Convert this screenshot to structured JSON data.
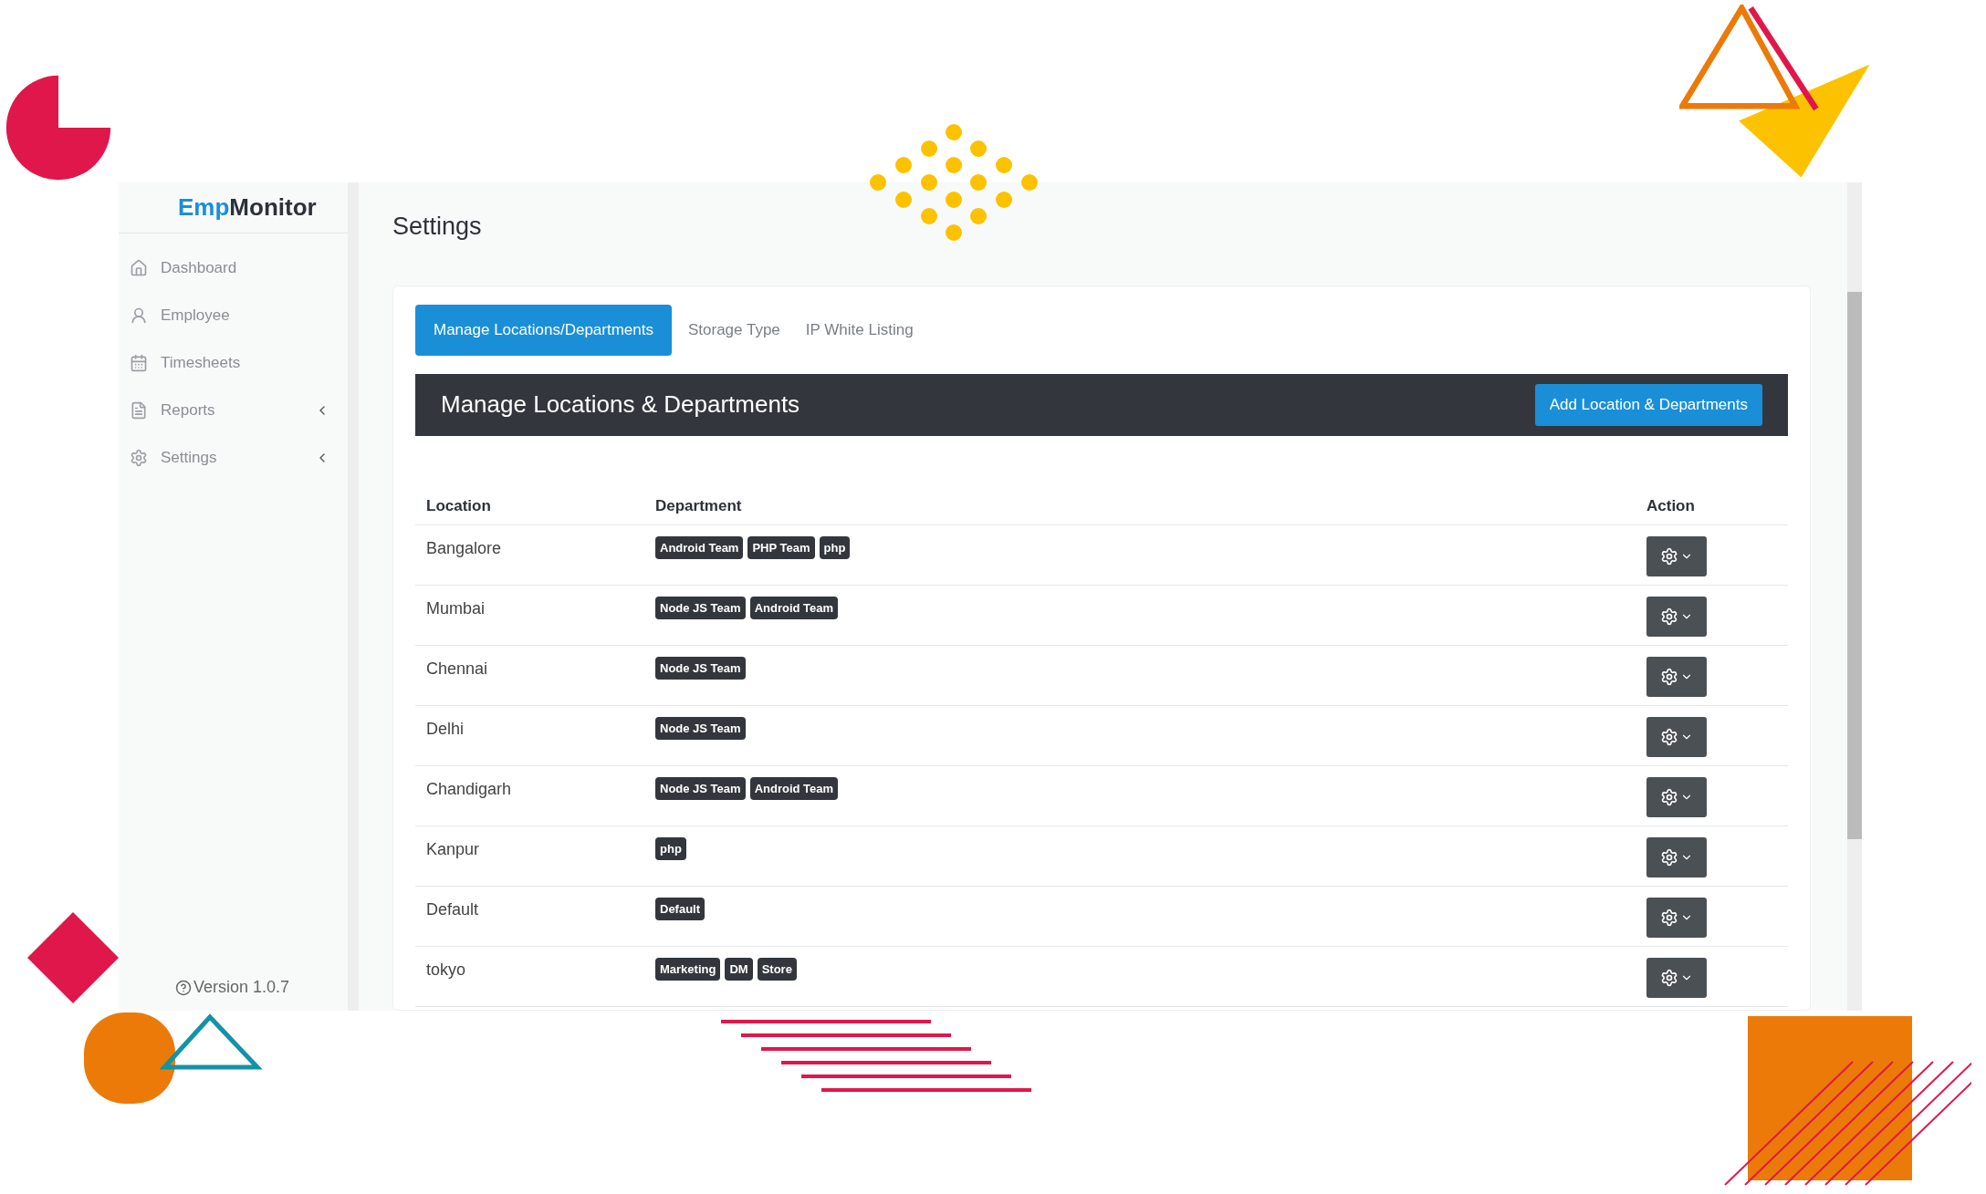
{
  "logo": {
    "parts": [
      "Emp",
      "Monitor"
    ]
  },
  "sidebar": {
    "items": [
      {
        "label": "Dashboard",
        "has_submenu": false
      },
      {
        "label": "Employee",
        "has_submenu": false
      },
      {
        "label": "Timesheets",
        "has_submenu": false
      },
      {
        "label": "Reports",
        "has_submenu": true
      },
      {
        "label": "Settings",
        "has_submenu": true
      }
    ],
    "version": "Version 1.0.7"
  },
  "page_title": "Settings",
  "tabs": [
    {
      "label": "Manage Locations/Departments",
      "selected": true
    },
    {
      "label": "Storage Type",
      "selected": false
    },
    {
      "label": "IP White Listing",
      "selected": false
    }
  ],
  "panel": {
    "title": "Manage Locations & Departments",
    "add_button": "Add Location & Departments"
  },
  "table": {
    "columns": [
      "Location",
      "Department",
      "Action"
    ],
    "rows": [
      {
        "location": "Bangalore",
        "departments": [
          "Android Team",
          "PHP Team",
          "php"
        ]
      },
      {
        "location": "Mumbai",
        "departments": [
          "Node JS Team",
          "Android Team"
        ]
      },
      {
        "location": "Chennai",
        "departments": [
          "Node JS Team"
        ]
      },
      {
        "location": "Delhi",
        "departments": [
          "Node JS Team"
        ]
      },
      {
        "location": "Chandigarh",
        "departments": [
          "Node JS Team",
          "Android Team"
        ]
      },
      {
        "location": "Kanpur",
        "departments": [
          "php"
        ]
      },
      {
        "location": "Default",
        "departments": [
          "Default"
        ]
      },
      {
        "location": "tokyo",
        "departments": [
          "Marketing",
          "DM",
          "Store"
        ]
      }
    ]
  }
}
